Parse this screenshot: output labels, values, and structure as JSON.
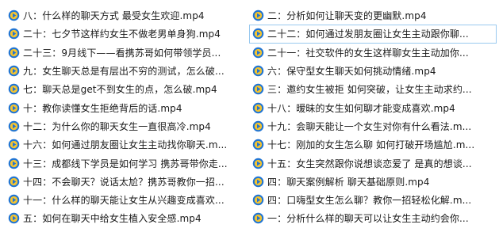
{
  "colors": {
    "icon_ring": "#1f74d4",
    "icon_fill": "#f4c431",
    "icon_play": "#1f74d4",
    "selection_border": "#99c9ef"
  },
  "icon_name": "media-file-icon",
  "selected_index": 13,
  "files": [
    "八：什么样的聊天方式 最受女生欢迎.mp4",
    "二十：七夕节这样约女生不做老男单身狗.mp4",
    "二十三：9月线下——看携苏哥如何带领学员...",
    "九：女生聊天总是有层出不穷的测试，怎么破...",
    "七：聊天总是get不到女生的点，怎么破.mp4",
    "十：教你读懂女生拒绝背后的话.mp4",
    "十二：为什么你的聊天女生一直很高冷.mp4",
    "十六：如何通过朋友圈让女生主动找你聊天.m...",
    "十三：成都线下学员是如何学习 携苏哥带你走...",
    "十四：不会聊天？说话太尬？携苏哥教你一招...",
    "十一：什么样的聊天能让女生从兴趣变成喜欢...",
    "五：如何在聊天中给女生植入安全感.mp4",
    "二：分析如何让聊天变的更幽默.mp4",
    "二十二：如何通过发朋友圈让女生主动跟你聊...",
    "二十一：社交软件的女生这样聊女生主动加你...",
    "六：保守型女生聊天如何挑动情绪.mp4",
    "三：邀约女生被拒 如何突破，让女生主动求约...",
    "十八：暧昧的女生如何聊才能变成喜欢.mp4",
    "十九：会聊天能让一个女生对你有什么看法.m...",
    "十七：刚加的女生怎么聊 如何打破开场尴尬.m...",
    "十五：女生突然跟你说想谈恋爱了 是真的想谈...",
    "四：聊天案例解析 聊天基础原则.mp4",
    "四：口嗨型女生怎么聊？教你一招轻松化解.m...",
    "一：分析什么样的聊天可以让女生主动约会你..."
  ]
}
